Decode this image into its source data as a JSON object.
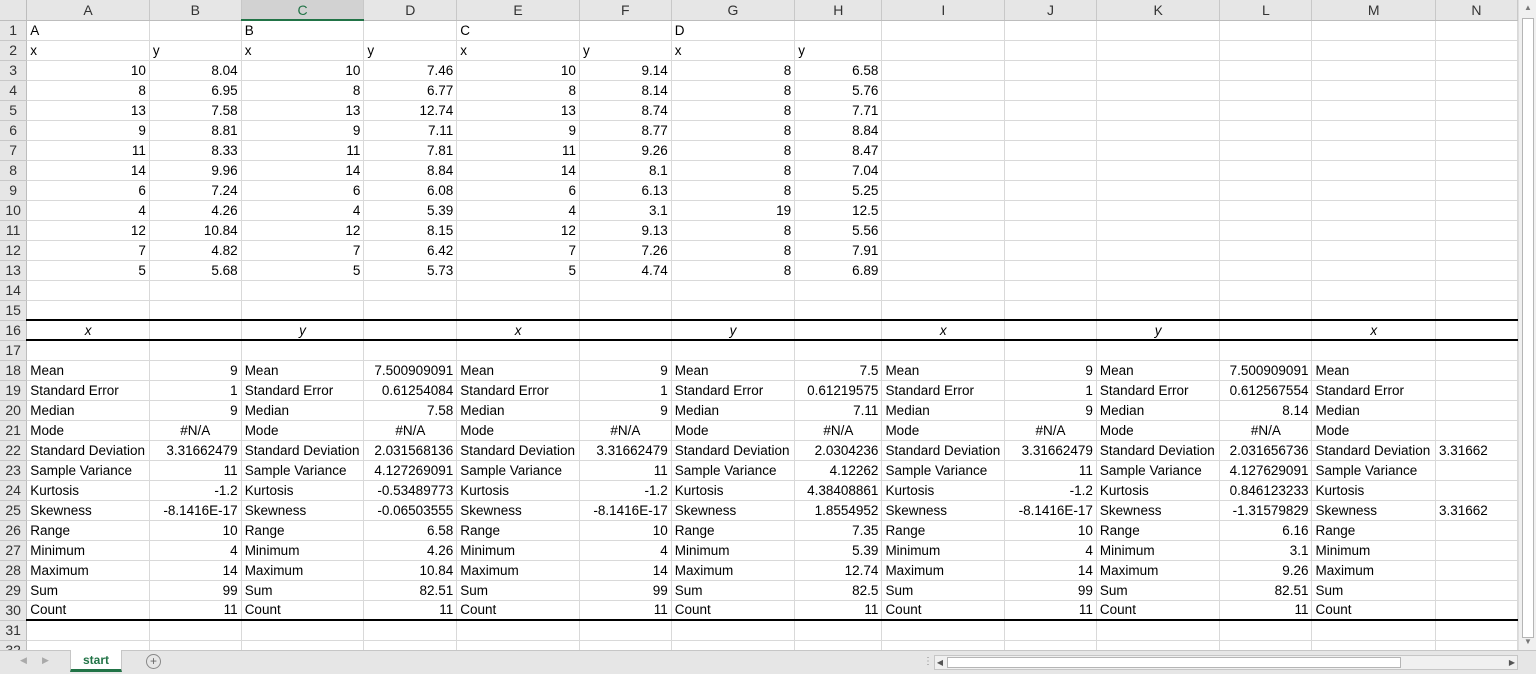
{
  "columns": [
    "A",
    "B",
    "C",
    "D",
    "E",
    "F",
    "G",
    "H",
    "I",
    "J",
    "K",
    "L",
    "M",
    "N"
  ],
  "selected_column": "C",
  "rows": [
    {
      "n": "1",
      "cells": [
        "A",
        "",
        "B",
        "",
        "C",
        "",
        "D",
        "",
        "",
        "",
        "",
        "",
        "",
        ""
      ]
    },
    {
      "n": "2",
      "cells": [
        "x",
        "y",
        "x",
        "y",
        "x",
        "y",
        "x",
        "y",
        "",
        "",
        "",
        "",
        "",
        ""
      ]
    },
    {
      "n": "3",
      "cells": [
        "10",
        "8.04",
        "10",
        "7.46",
        "10",
        "9.14",
        "8",
        "6.58",
        "",
        "",
        "",
        "",
        "",
        ""
      ]
    },
    {
      "n": "4",
      "cells": [
        "8",
        "6.95",
        "8",
        "6.77",
        "8",
        "8.14",
        "8",
        "5.76",
        "",
        "",
        "",
        "",
        "",
        ""
      ]
    },
    {
      "n": "5",
      "cells": [
        "13",
        "7.58",
        "13",
        "12.74",
        "13",
        "8.74",
        "8",
        "7.71",
        "",
        "",
        "",
        "",
        "",
        ""
      ]
    },
    {
      "n": "6",
      "cells": [
        "9",
        "8.81",
        "9",
        "7.11",
        "9",
        "8.77",
        "8",
        "8.84",
        "",
        "",
        "",
        "",
        "",
        ""
      ]
    },
    {
      "n": "7",
      "cells": [
        "11",
        "8.33",
        "11",
        "7.81",
        "11",
        "9.26",
        "8",
        "8.47",
        "",
        "",
        "",
        "",
        "",
        ""
      ]
    },
    {
      "n": "8",
      "cells": [
        "14",
        "9.96",
        "14",
        "8.84",
        "14",
        "8.1",
        "8",
        "7.04",
        "",
        "",
        "",
        "",
        "",
        ""
      ]
    },
    {
      "n": "9",
      "cells": [
        "6",
        "7.24",
        "6",
        "6.08",
        "6",
        "6.13",
        "8",
        "5.25",
        "",
        "",
        "",
        "",
        "",
        ""
      ]
    },
    {
      "n": "10",
      "cells": [
        "4",
        "4.26",
        "4",
        "5.39",
        "4",
        "3.1",
        "19",
        "12.5",
        "",
        "",
        "",
        "",
        "",
        ""
      ]
    },
    {
      "n": "11",
      "cells": [
        "12",
        "10.84",
        "12",
        "8.15",
        "12",
        "9.13",
        "8",
        "5.56",
        "",
        "",
        "",
        "",
        "",
        ""
      ]
    },
    {
      "n": "12",
      "cells": [
        "7",
        "4.82",
        "7",
        "6.42",
        "7",
        "7.26",
        "8",
        "7.91",
        "",
        "",
        "",
        "",
        "",
        ""
      ]
    },
    {
      "n": "13",
      "cells": [
        "5",
        "5.68",
        "5",
        "5.73",
        "5",
        "4.74",
        "8",
        "6.89",
        "",
        "",
        "",
        "",
        "",
        ""
      ]
    },
    {
      "n": "14",
      "cells": [
        "",
        "",
        "",
        "",
        "",
        "",
        "",
        "",
        "",
        "",
        "",
        "",
        "",
        ""
      ]
    },
    {
      "n": "15",
      "cells": [
        "",
        "",
        "",
        "",
        "",
        "",
        "",
        "",
        "",
        "",
        "",
        "",
        "",
        ""
      ]
    },
    {
      "n": "16",
      "cells": [
        "x",
        "",
        "y",
        "",
        "x",
        "",
        "y",
        "",
        "x",
        "",
        "y",
        "",
        "x",
        ""
      ]
    },
    {
      "n": "17",
      "cells": [
        "",
        "",
        "",
        "",
        "",
        "",
        "",
        "",
        "",
        "",
        "",
        "",
        "",
        ""
      ]
    },
    {
      "n": "18",
      "cells": [
        "Mean",
        "9",
        "Mean",
        "7.500909091",
        "Mean",
        "9",
        "Mean",
        "7.5",
        "Mean",
        "9",
        "Mean",
        "7.500909091",
        "Mean",
        ""
      ]
    },
    {
      "n": "19",
      "cells": [
        "Standard Error",
        "1",
        "Standard Error",
        "0.61254084",
        "Standard Error",
        "1",
        "Standard Error",
        "0.61219575",
        "Standard Error",
        "1",
        "Standard Error",
        "0.612567554",
        "Standard Error",
        ""
      ]
    },
    {
      "n": "20",
      "cells": [
        "Median",
        "9",
        "Median",
        "7.58",
        "Median",
        "9",
        "Median",
        "7.11",
        "Median",
        "9",
        "Median",
        "8.14",
        "Median",
        ""
      ]
    },
    {
      "n": "21",
      "cells": [
        "Mode",
        "#N/A",
        "Mode",
        "#N/A",
        "Mode",
        "#N/A",
        "Mode",
        "#N/A",
        "Mode",
        "#N/A",
        "Mode",
        "#N/A",
        "Mode",
        ""
      ]
    },
    {
      "n": "22",
      "cells": [
        "Standard Deviation",
        "3.31662479",
        "Standard Deviation",
        "2.031568136",
        "Standard Deviation",
        "3.31662479",
        "Standard Deviation",
        "2.0304236",
        "Standard Deviation",
        "3.31662479",
        "Standard Deviation",
        "2.031656736",
        "Standard Deviation",
        "3.31662"
      ]
    },
    {
      "n": "23",
      "cells": [
        "Sample Variance",
        "11",
        "Sample Variance",
        "4.127269091",
        "Sample Variance",
        "11",
        "Sample Variance",
        "4.12262",
        "Sample Variance",
        "11",
        "Sample Variance",
        "4.127629091",
        "Sample Variance",
        ""
      ]
    },
    {
      "n": "24",
      "cells": [
        "Kurtosis",
        "-1.2",
        "Kurtosis",
        "-0.53489773",
        "Kurtosis",
        "-1.2",
        "Kurtosis",
        "4.38408861",
        "Kurtosis",
        "-1.2",
        "Kurtosis",
        "0.846123233",
        "Kurtosis",
        ""
      ]
    },
    {
      "n": "25",
      "cells": [
        "Skewness",
        "-8.1416E-17",
        "Skewness",
        "-0.06503555",
        "Skewness",
        "-8.1416E-17",
        "Skewness",
        "1.8554952",
        "Skewness",
        "-8.1416E-17",
        "Skewness",
        "-1.31579829",
        "Skewness",
        "3.31662"
      ]
    },
    {
      "n": "26",
      "cells": [
        "Range",
        "10",
        "Range",
        "6.58",
        "Range",
        "10",
        "Range",
        "7.35",
        "Range",
        "10",
        "Range",
        "6.16",
        "Range",
        ""
      ]
    },
    {
      "n": "27",
      "cells": [
        "Minimum",
        "4",
        "Minimum",
        "4.26",
        "Minimum",
        "4",
        "Minimum",
        "5.39",
        "Minimum",
        "4",
        "Minimum",
        "3.1",
        "Minimum",
        ""
      ]
    },
    {
      "n": "28",
      "cells": [
        "Maximum",
        "14",
        "Maximum",
        "10.84",
        "Maximum",
        "14",
        "Maximum",
        "12.74",
        "Maximum",
        "14",
        "Maximum",
        "9.26",
        "Maximum",
        ""
      ]
    },
    {
      "n": "29",
      "cells": [
        "Sum",
        "99",
        "Sum",
        "82.51",
        "Sum",
        "99",
        "Sum",
        "82.5",
        "Sum",
        "99",
        "Sum",
        "82.51",
        "Sum",
        ""
      ]
    },
    {
      "n": "30",
      "cells": [
        "Count",
        "11",
        "Count",
        "11",
        "Count",
        "11",
        "Count",
        "11",
        "Count",
        "11",
        "Count",
        "11",
        "Count",
        ""
      ]
    },
    {
      "n": "31",
      "cells": [
        "",
        "",
        "",
        "",
        "",
        "",
        "",
        "",
        "",
        "",
        "",
        "",
        "",
        ""
      ]
    },
    {
      "n": "32",
      "cells": [
        "",
        "",
        "",
        "",
        "",
        "",
        "",
        "",
        "",
        "",
        "",
        "",
        "",
        ""
      ]
    }
  ],
  "sheet_tabs": [
    {
      "label": "start",
      "active": true
    }
  ],
  "add_sheet_icon": "plus-circle-icon",
  "accent_color": "#217346"
}
